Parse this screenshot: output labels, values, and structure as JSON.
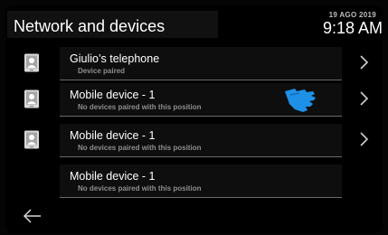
{
  "header": {
    "title": "Network and devices",
    "date": "19 AGO 2019",
    "time": "9:18 AM"
  },
  "rows": [
    {
      "name": "Giulio’s telephone",
      "status": "Device paired",
      "icon": "phone-icon",
      "has_arrow": true
    },
    {
      "name": "Mobile device - 1",
      "status": "No devices paired with this position",
      "icon": "phone-icon",
      "has_arrow": true
    },
    {
      "name": "Mobile device - 1",
      "status": "No devices paired with this position",
      "icon": "phone-icon",
      "has_arrow": true
    },
    {
      "name": "Mobile device - 1",
      "status": "No devices paired with this position",
      "icon": null,
      "has_arrow": false
    }
  ],
  "icons": {
    "back": "back-arrow-icon",
    "chevron": "chevron-right-icon",
    "hand": "tap-hand-icon"
  },
  "colors": {
    "background": "#000000",
    "text": "#ffffff",
    "muted_text": "#8e8e8e",
    "hand_accent": "#1e90e6",
    "divider": "#6a6a6a"
  }
}
